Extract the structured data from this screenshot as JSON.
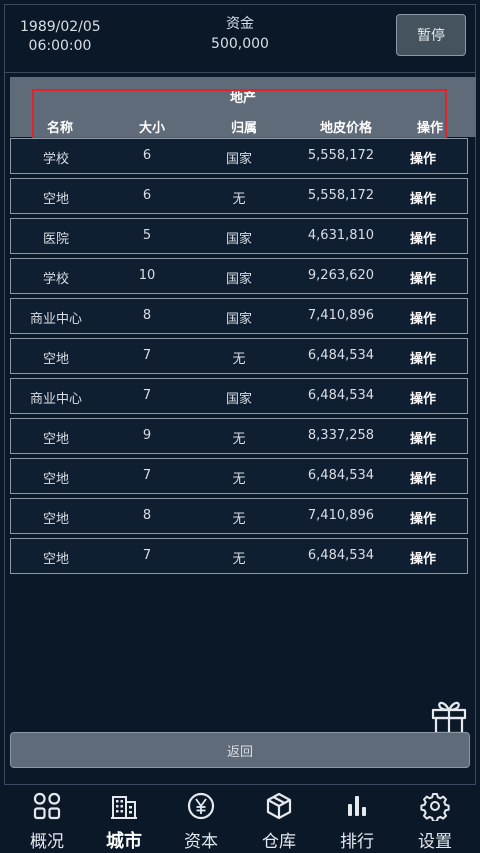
{
  "header": {
    "date": "1989/02/05",
    "time": "06:00:00",
    "funds_label": "资金",
    "funds_value": "500,000",
    "pause_label": "暂停"
  },
  "table": {
    "title": "地产",
    "columns": [
      "名称",
      "大小",
      "归属",
      "地皮价格",
      "操作"
    ],
    "rows": [
      {
        "name": "学校",
        "size": "6",
        "owner": "国家",
        "price": "5,558,172",
        "action": "操作"
      },
      {
        "name": "空地",
        "size": "6",
        "owner": "无",
        "price": "5,558,172",
        "action": "操作"
      },
      {
        "name": "医院",
        "size": "5",
        "owner": "国家",
        "price": "4,631,810",
        "action": "操作"
      },
      {
        "name": "学校",
        "size": "10",
        "owner": "国家",
        "price": "9,263,620",
        "action": "操作"
      },
      {
        "name": "商业中心",
        "size": "8",
        "owner": "国家",
        "price": "7,410,896",
        "action": "操作"
      },
      {
        "name": "空地",
        "size": "7",
        "owner": "无",
        "price": "6,484,534",
        "action": "操作"
      },
      {
        "name": "商业中心",
        "size": "7",
        "owner": "国家",
        "price": "6,484,534",
        "action": "操作"
      },
      {
        "name": "空地",
        "size": "9",
        "owner": "无",
        "price": "8,337,258",
        "action": "操作"
      },
      {
        "name": "空地",
        "size": "7",
        "owner": "无",
        "price": "6,484,534",
        "action": "操作"
      },
      {
        "name": "空地",
        "size": "8",
        "owner": "无",
        "price": "7,410,896",
        "action": "操作"
      },
      {
        "name": "空地",
        "size": "7",
        "owner": "无",
        "price": "6,484,534",
        "action": "操作"
      }
    ]
  },
  "back_label": "返回",
  "gift_icon": "gift-icon",
  "nav": [
    {
      "label": "概况",
      "icon": "grid-icon",
      "active": false
    },
    {
      "label": "城市",
      "icon": "buildings-icon",
      "active": true
    },
    {
      "label": "资本",
      "icon": "yen-coin-icon",
      "active": false
    },
    {
      "label": "仓库",
      "icon": "box-icon",
      "active": false
    },
    {
      "label": "排行",
      "icon": "bar-chart-icon",
      "active": false
    },
    {
      "label": "设置",
      "icon": "gear-icon",
      "active": false
    }
  ],
  "colors": {
    "background": "#0b1828",
    "header_bar": "#5f6b78",
    "highlight_box": "#e0242a"
  }
}
